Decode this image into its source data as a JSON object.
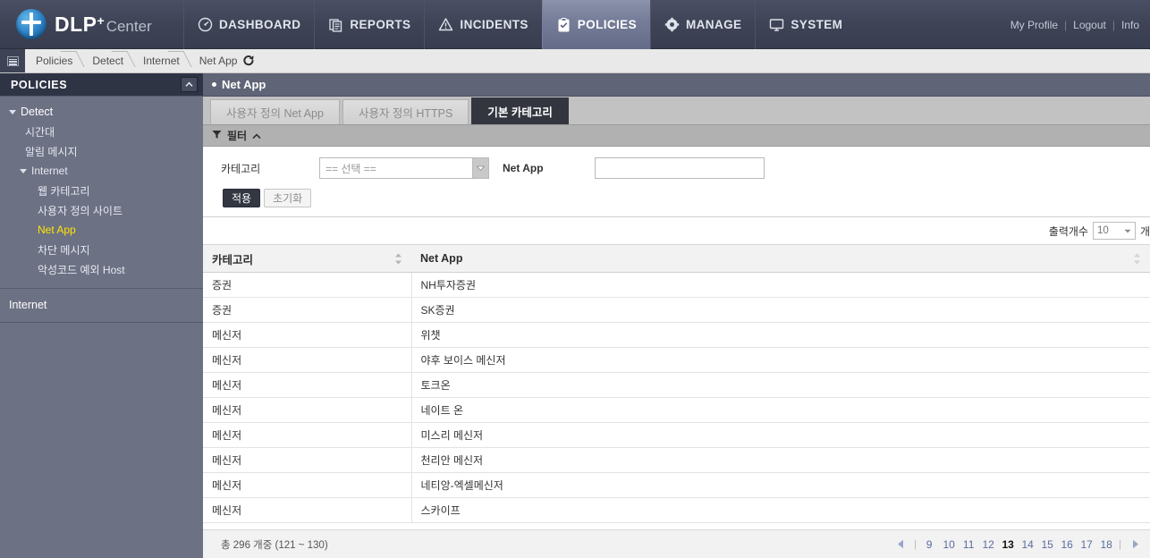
{
  "header": {
    "logo": {
      "main": "DLP",
      "plus": "+",
      "sub": "Center"
    },
    "nav": [
      {
        "label": "DASHBOARD",
        "icon": "gauge-icon",
        "active": false
      },
      {
        "label": "REPORTS",
        "icon": "report-icon",
        "active": false
      },
      {
        "label": "INCIDENTS",
        "icon": "warning-icon",
        "active": false
      },
      {
        "label": "POLICIES",
        "icon": "clipboard-icon",
        "active": true
      },
      {
        "label": "MANAGE",
        "icon": "gear-icon",
        "active": false
      },
      {
        "label": "SYSTEM",
        "icon": "monitor-icon",
        "active": false
      }
    ],
    "my_profile": "My Profile",
    "logout": "Logout",
    "info": "Info",
    "separator": "|"
  },
  "breadcrumb": {
    "items": [
      "Policies",
      "Detect",
      "Internet",
      "Net App"
    ]
  },
  "sidebar": {
    "title": "POLICIES",
    "tree": [
      {
        "label": "Detect",
        "level": 0,
        "expandable": true,
        "current": false
      },
      {
        "label": "시간대",
        "level": 1,
        "expandable": false,
        "current": false
      },
      {
        "label": "알림 메시지",
        "level": 1,
        "expandable": false,
        "current": false
      },
      {
        "label": "Internet",
        "level": 1,
        "expandable": true,
        "current": false
      },
      {
        "label": "웹 카테고리",
        "level": 2,
        "expandable": false,
        "current": false
      },
      {
        "label": "사용자 정의 사이트",
        "level": 2,
        "expandable": false,
        "current": false
      },
      {
        "label": "Net App",
        "level": 2,
        "expandable": false,
        "current": true
      },
      {
        "label": "차단 메시지",
        "level": 2,
        "expandable": false,
        "current": false
      },
      {
        "label": "악성코드 예외 Host",
        "level": 2,
        "expandable": false,
        "current": false
      }
    ],
    "section2": "Internet"
  },
  "main": {
    "page_title": "Net App",
    "tabs": [
      {
        "label": "사용자 정의 Net App",
        "active": false
      },
      {
        "label": "사용자 정의 HTTPS",
        "active": false
      },
      {
        "label": "기본 카테고리",
        "active": true
      }
    ],
    "filter": {
      "title": "필터",
      "category_label": "카테고리",
      "category_value": "== 선택 ==",
      "netapp_label": "Net App",
      "netapp_value": "",
      "netapp_placeholder": "",
      "apply_button": "적용",
      "reset_button": "초기화"
    },
    "page_size": {
      "label": "출력개수",
      "value": "10",
      "unit": "개"
    },
    "table": {
      "columns": [
        "카테고리",
        "Net App"
      ],
      "rows": [
        {
          "category": "증권",
          "netapp": "NH투자증권"
        },
        {
          "category": "증권",
          "netapp": "SK증권"
        },
        {
          "category": "메신저",
          "netapp": "위챗"
        },
        {
          "category": "메신저",
          "netapp": "야후 보이스 메신저"
        },
        {
          "category": "메신저",
          "netapp": "토크온"
        },
        {
          "category": "메신저",
          "netapp": "네이트 온"
        },
        {
          "category": "메신저",
          "netapp": "미스리 메신저"
        },
        {
          "category": "메신저",
          "netapp": "천리안 메신저"
        },
        {
          "category": "메신저",
          "netapp": "네티앙-엑셀메신저"
        },
        {
          "category": "메신저",
          "netapp": "스카이프"
        }
      ]
    },
    "footer": {
      "record_count": "총 296 개중 (121 ~ 130)",
      "pages": [
        "9",
        "10",
        "11",
        "12",
        "13",
        "14",
        "15",
        "16",
        "17",
        "18"
      ],
      "active_page": "13"
    }
  },
  "colors": {
    "header_bg": "#3e4356",
    "active_nav": "#767e99",
    "sidebar_bg": "#6d7184",
    "highlight": "#ffe600",
    "tab_active": "#33363f"
  }
}
